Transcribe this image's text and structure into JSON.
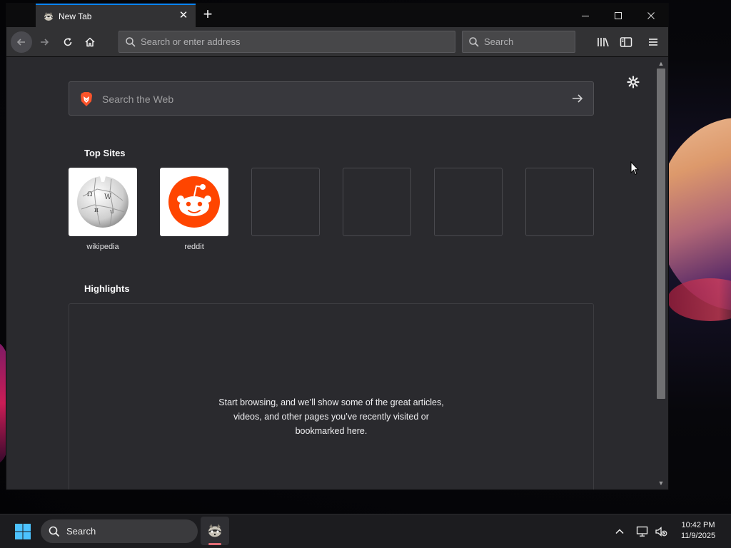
{
  "browser": {
    "tab": {
      "title": "New Tab",
      "close_glyph": "✕",
      "favicon": "raccoon-icon"
    },
    "new_tab_glyph": "+",
    "url_placeholder": "Search or enter address",
    "search_placeholder": "Search"
  },
  "newtab": {
    "web_search_placeholder": "Search the Web",
    "top_sites_title": "Top Sites",
    "top_sites": [
      {
        "label": "wikipedia",
        "icon": "wikipedia-globe-icon"
      },
      {
        "label": "reddit",
        "icon": "reddit-icon"
      }
    ],
    "empty_tiles": 4,
    "highlights_title": "Highlights",
    "highlights_empty_lines": [
      "Start browsing, and we’ll show some of the great articles,",
      "videos, and other pages you’ve recently visited or",
      "bookmarked here."
    ]
  },
  "taskbar": {
    "search_label": "Search",
    "time": "10:42 PM",
    "date": "11/9/2025"
  },
  "colors": {
    "accent": "#0a84ff",
    "reddit": "#ff4500",
    "brave": "#fb542b"
  }
}
